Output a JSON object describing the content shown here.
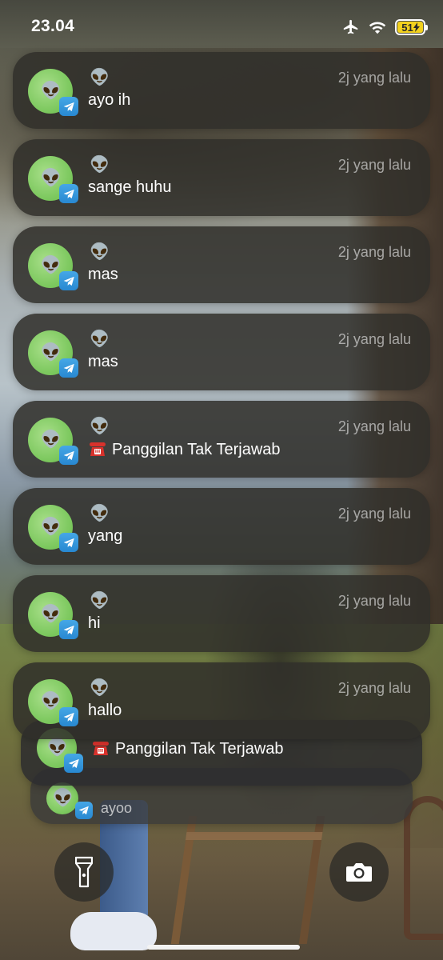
{
  "status_bar": {
    "time": "23.04",
    "battery_level": "51",
    "icons": [
      "airplane-icon",
      "wifi-icon",
      "battery-charging-icon"
    ],
    "battery_color": "#f2d11e"
  },
  "notifications": [
    {
      "sender": "👽",
      "time_ago": "2j yang lalu",
      "message": "ayo ih",
      "app_icon": "telegram-icon"
    },
    {
      "sender": "👽",
      "time_ago": "2j yang lalu",
      "message": "sange huhu",
      "app_icon": "telegram-icon"
    },
    {
      "sender": "👽",
      "time_ago": "2j yang lalu",
      "message": "mas",
      "app_icon": "telegram-icon"
    },
    {
      "sender": "👽",
      "time_ago": "2j yang lalu",
      "message": "mas",
      "app_icon": "telegram-icon"
    },
    {
      "sender": "👽",
      "time_ago": "2j yang lalu",
      "message": "Panggilan Tak Terjawab",
      "message_icon": "telephone-icon",
      "app_icon": "telegram-icon"
    },
    {
      "sender": "👽",
      "time_ago": "2j yang lalu",
      "message": "yang",
      "app_icon": "telegram-icon"
    },
    {
      "sender": "👽",
      "time_ago": "2j yang lalu",
      "message": "hi",
      "app_icon": "telegram-icon"
    },
    {
      "sender": "👽",
      "time_ago": "2j yang lalu",
      "message": "hallo",
      "app_icon": "telegram-icon"
    }
  ],
  "stacked_notifications": [
    {
      "message": "Panggilan Tak Terjawab",
      "message_icon": "telephone-icon"
    },
    {
      "message": "ayoo"
    }
  ],
  "bottom_controls": {
    "left": "flashlight-icon",
    "right": "camera-icon"
  },
  "colors": {
    "avatar_green": "#7cc85e",
    "telegram_blue": "#2888d1",
    "card_bg": "rgba(48,46,42,0.86)"
  }
}
